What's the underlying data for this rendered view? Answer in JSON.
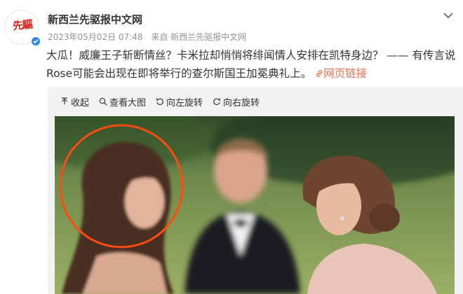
{
  "post": {
    "author": {
      "name": "新西兰先驱报中文网",
      "avatar_text": "先驅",
      "verified_icon": "verified-badge-icon"
    },
    "meta": {
      "timestamp": "2023年05月02日 07:48",
      "source": "来自 新西兰先驱报中文网"
    },
    "text": "大瓜！威廉王子斩断情丝？卡米拉却悄悄将绯闻情人安排在凯特身边？ —— 有传言说Rose可能会出现在即将举行的查尔斯国王加冕典礼上。",
    "link_label": "网页链接"
  },
  "toolbar": {
    "collapse": "收起",
    "view_large": "查看大图",
    "rotate_left": "向左旋转",
    "rotate_right": "向右旋转"
  },
  "colors": {
    "link": "#eb7350",
    "verified": "#2e8ae6",
    "highlight_circle": "#ff4a12",
    "avatar_text": "#d9261c"
  }
}
